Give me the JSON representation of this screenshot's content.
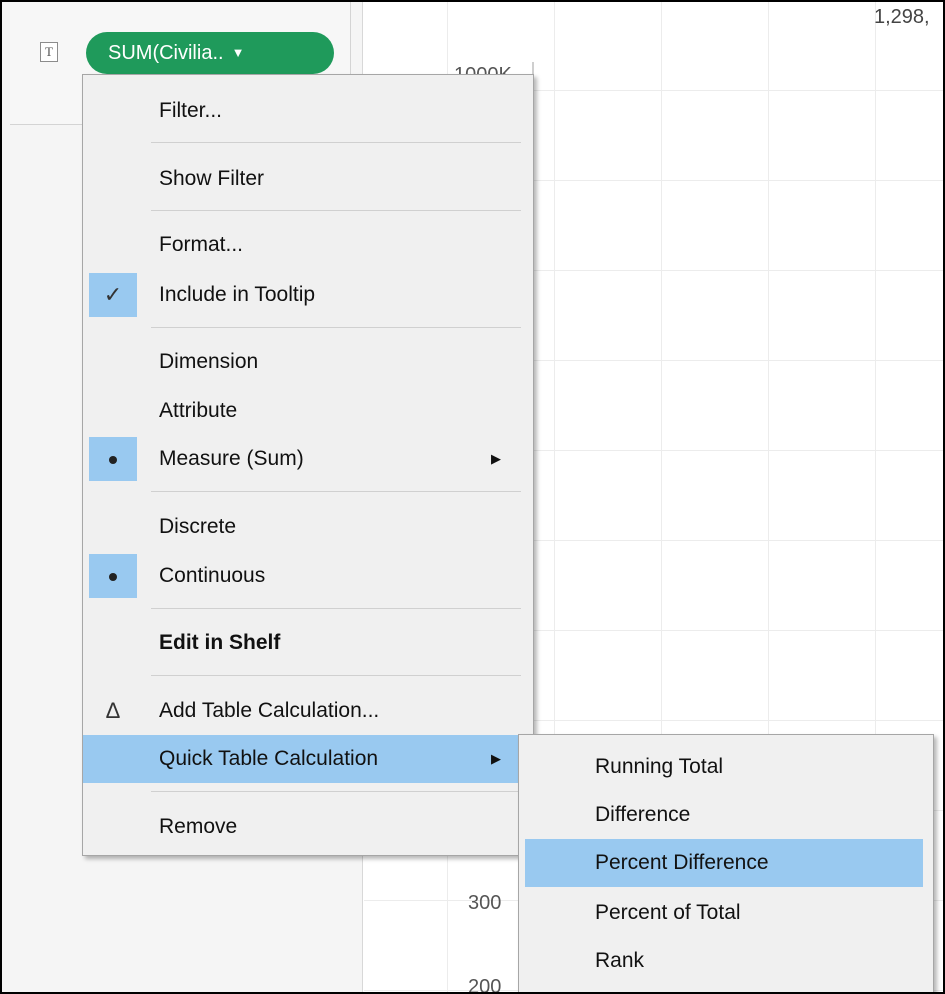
{
  "shelf": {
    "mark_type_icon": "text-mark-icon",
    "mark_type_glyph": "T",
    "pill_label": "SUM(Civilia..",
    "pill_caret": "▼",
    "pill_color": "#1f9a5b"
  },
  "chart": {
    "top_label": "1,298,",
    "axis_ticks": [
      "1000K",
      "300",
      "200"
    ]
  },
  "context_menu": {
    "items": [
      {
        "label": "Filter...",
        "check": ""
      },
      {
        "label": "Show Filter",
        "check": ""
      },
      {
        "label": "Format...",
        "check": ""
      },
      {
        "label": "Include in Tooltip",
        "check": "✓"
      },
      {
        "label": "Dimension",
        "check": ""
      },
      {
        "label": "Attribute",
        "check": ""
      },
      {
        "label": "Measure (Sum)",
        "check": "dot",
        "arrow": "▶"
      },
      {
        "label": "Discrete",
        "check": ""
      },
      {
        "label": "Continuous",
        "check": "dot"
      },
      {
        "label": "Edit in Shelf",
        "check": "",
        "bold": true
      },
      {
        "label": "Add Table Calculation...",
        "check": "Δ"
      },
      {
        "label": "Quick Table Calculation",
        "check": "",
        "arrow": "▶",
        "highlighted": true
      },
      {
        "label": "Remove",
        "check": ""
      }
    ]
  },
  "submenu": {
    "items": [
      {
        "label": "Running Total"
      },
      {
        "label": "Difference"
      },
      {
        "label": "Percent Difference",
        "highlighted": true
      },
      {
        "label": "Percent of Total"
      },
      {
        "label": "Rank"
      }
    ]
  },
  "colors": {
    "highlight": "#99c9f0",
    "menu_bg": "#f0f0f0"
  }
}
